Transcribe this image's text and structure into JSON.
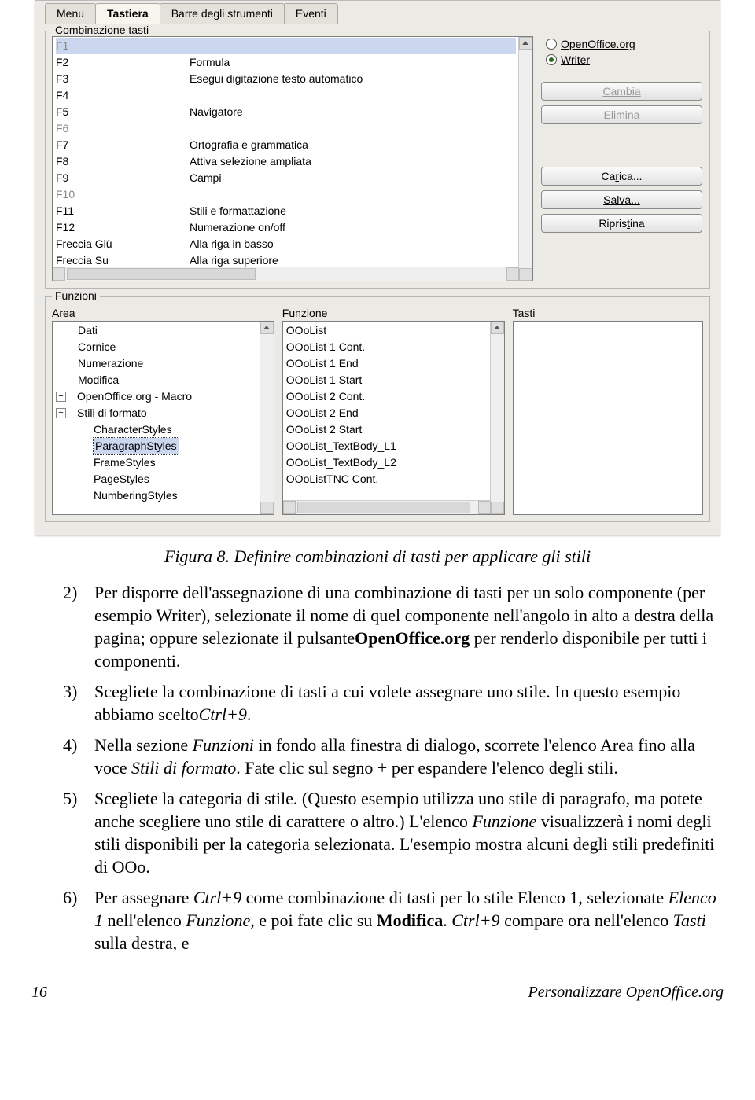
{
  "tabs": {
    "menu": "Menu",
    "tastiera": "Tastiera",
    "barre": "Barre degli strumenti",
    "eventi": "Eventi"
  },
  "group_keys_title": "Combinazione tasti",
  "keys": [
    {
      "k": "F1",
      "v": "",
      "sel": true,
      "dis": true
    },
    {
      "k": "F2",
      "v": "Formula"
    },
    {
      "k": "F3",
      "v": "Esegui digitazione testo automatico"
    },
    {
      "k": "F4",
      "v": ""
    },
    {
      "k": "F5",
      "v": "Navigatore"
    },
    {
      "k": "F6",
      "v": "",
      "dis": true
    },
    {
      "k": "F7",
      "v": "Ortografia e grammatica"
    },
    {
      "k": "F8",
      "v": "Attiva selezione ampliata"
    },
    {
      "k": "F9",
      "v": "Campi"
    },
    {
      "k": "F10",
      "v": "",
      "dis": true
    },
    {
      "k": "F11",
      "v": "Stili e formattazione"
    },
    {
      "k": "F12",
      "v": "Numerazione on/off"
    },
    {
      "k": "Freccia Giù",
      "v": "Alla riga in basso"
    },
    {
      "k": "Freccia Su",
      "v": "Alla riga superiore"
    }
  ],
  "radios": {
    "openoffice": "OpenOffice.org",
    "writer": "Writer"
  },
  "buttons": {
    "cambia": "Cambia",
    "elimina": "Elimina",
    "carica": "Carica...",
    "salva": "Salva...",
    "ripristina": "Ripristina"
  },
  "group_fn_title": "Funzioni",
  "labels": {
    "area": "Area",
    "funzione": "Funzione",
    "tasti": "Tasti"
  },
  "area_tree": {
    "top": [
      "Dati",
      "Cornice",
      "Numerazione",
      "Modifica"
    ],
    "macro": {
      "exp": "+",
      "label": "OpenOffice.org - Macro"
    },
    "stili": {
      "exp": "−",
      "label": "Stili di formato",
      "children": [
        "CharacterStyles",
        "ParagraphStyles",
        "FrameStyles",
        "PageStyles",
        "NumberingStyles"
      ],
      "selected": "ParagraphStyles"
    }
  },
  "func_list": [
    "OOoList",
    "OOoList 1 Cont.",
    "OOoList 1 End",
    "OOoList 1 Start",
    "OOoList 2 Cont.",
    "OOoList 2 End",
    "OOoList 2 Start",
    "OOoList_TextBody_L1",
    "OOoList_TextBody_L2",
    "OOoListTNC Cont."
  ],
  "caption": "Figura 8. Definire combinazioni di tasti per applicare gli stili",
  "step2": {
    "a": "Per disporre dell'assegnazione di una combinazione di tasti per un solo componente (per esempio Writer), selezionate il nome di quel componente nell'angolo in alto a destra della pagina; oppure selezionate il pulsante",
    "b": "OpenOffice.org",
    "c": " per renderlo disponibile per tutti i componenti."
  },
  "step3": {
    "a": "Scegliete la combinazione di tasti a cui volete assegnare uno stile. In questo esempio abbiamo scelto",
    "b": "Ctrl+9",
    "c": "."
  },
  "step4": {
    "a": "Nella sezione ",
    "b": "Funzioni",
    "c": " in fondo alla finestra di dialogo, scorrete l'elenco Area fino alla voce ",
    "d": "Stili di formato",
    "e": ". Fate clic sul segno + per espandere l'elenco degli stili."
  },
  "step5": {
    "a": "Scegliete la categoria di stile. (Questo esempio utilizza uno stile di paragrafo, ma potete anche scegliere uno stile di carattere o altro.) L'elenco ",
    "b": "Funzione",
    "c": " visualizzerà i nomi degli stili disponibili per la categoria selezionata. L'esempio mostra alcuni degli stili predefiniti di OOo."
  },
  "step6": {
    "a": "Per assegnare ",
    "b": "Ctrl+9",
    "c": " come combinazione di tasti per lo stile Elenco 1, selezionate ",
    "d": "Elenco 1",
    "e": " nell'elenco ",
    "f": "Funzione",
    "g": ", e poi fate clic su ",
    "h": "Modifica",
    "i": ". ",
    "j": "Ctrl+9",
    "k": " compare ora nell'elenco ",
    "l": "Tasti",
    "m": " sulla destra, e"
  },
  "footer": {
    "page": "16",
    "title": "Personalizzare OpenOffice.org"
  }
}
